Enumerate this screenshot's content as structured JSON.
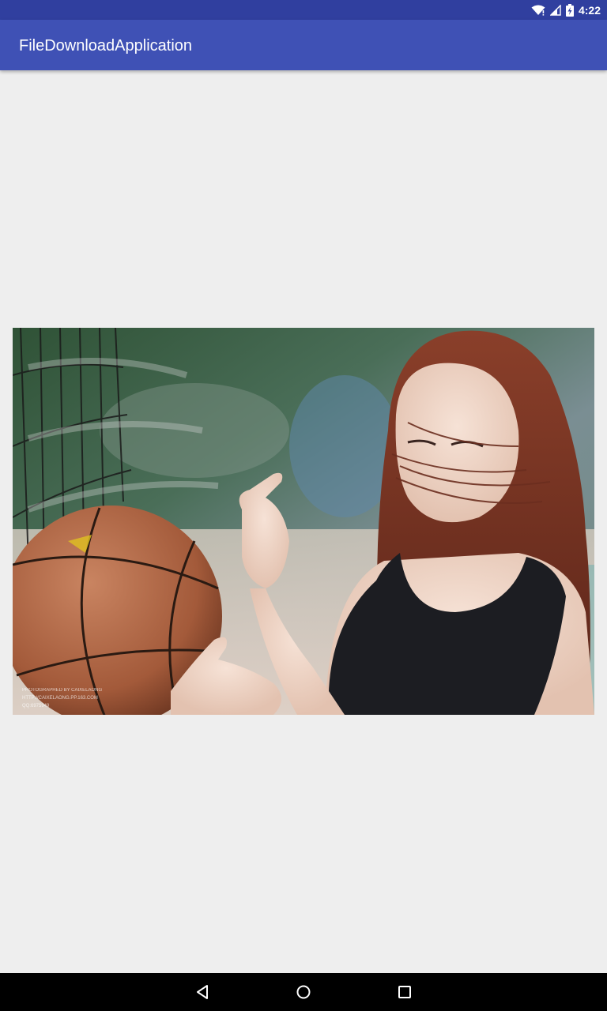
{
  "status_bar": {
    "time": "4:22",
    "icons": [
      "wifi-icon",
      "cell-signal-icon",
      "battery-charging-icon"
    ]
  },
  "app_bar": {
    "title": "FileDownloadApplication"
  },
  "main": {
    "image": {
      "description_icon": "downloaded-photo",
      "watermark_lines": [
        "PHOTOGRAPHED BY CAIXELAONG",
        "HTTP://CAIXELAONG.PP.163.COM",
        "QQ:6975949"
      ]
    }
  },
  "nav_bar": {
    "icons": [
      "back-icon",
      "home-icon",
      "recents-icon"
    ]
  },
  "colors": {
    "status_bar": "#303f9f",
    "app_bar": "#3f51b5",
    "background": "#eeeeee",
    "nav_bar": "#000000"
  }
}
